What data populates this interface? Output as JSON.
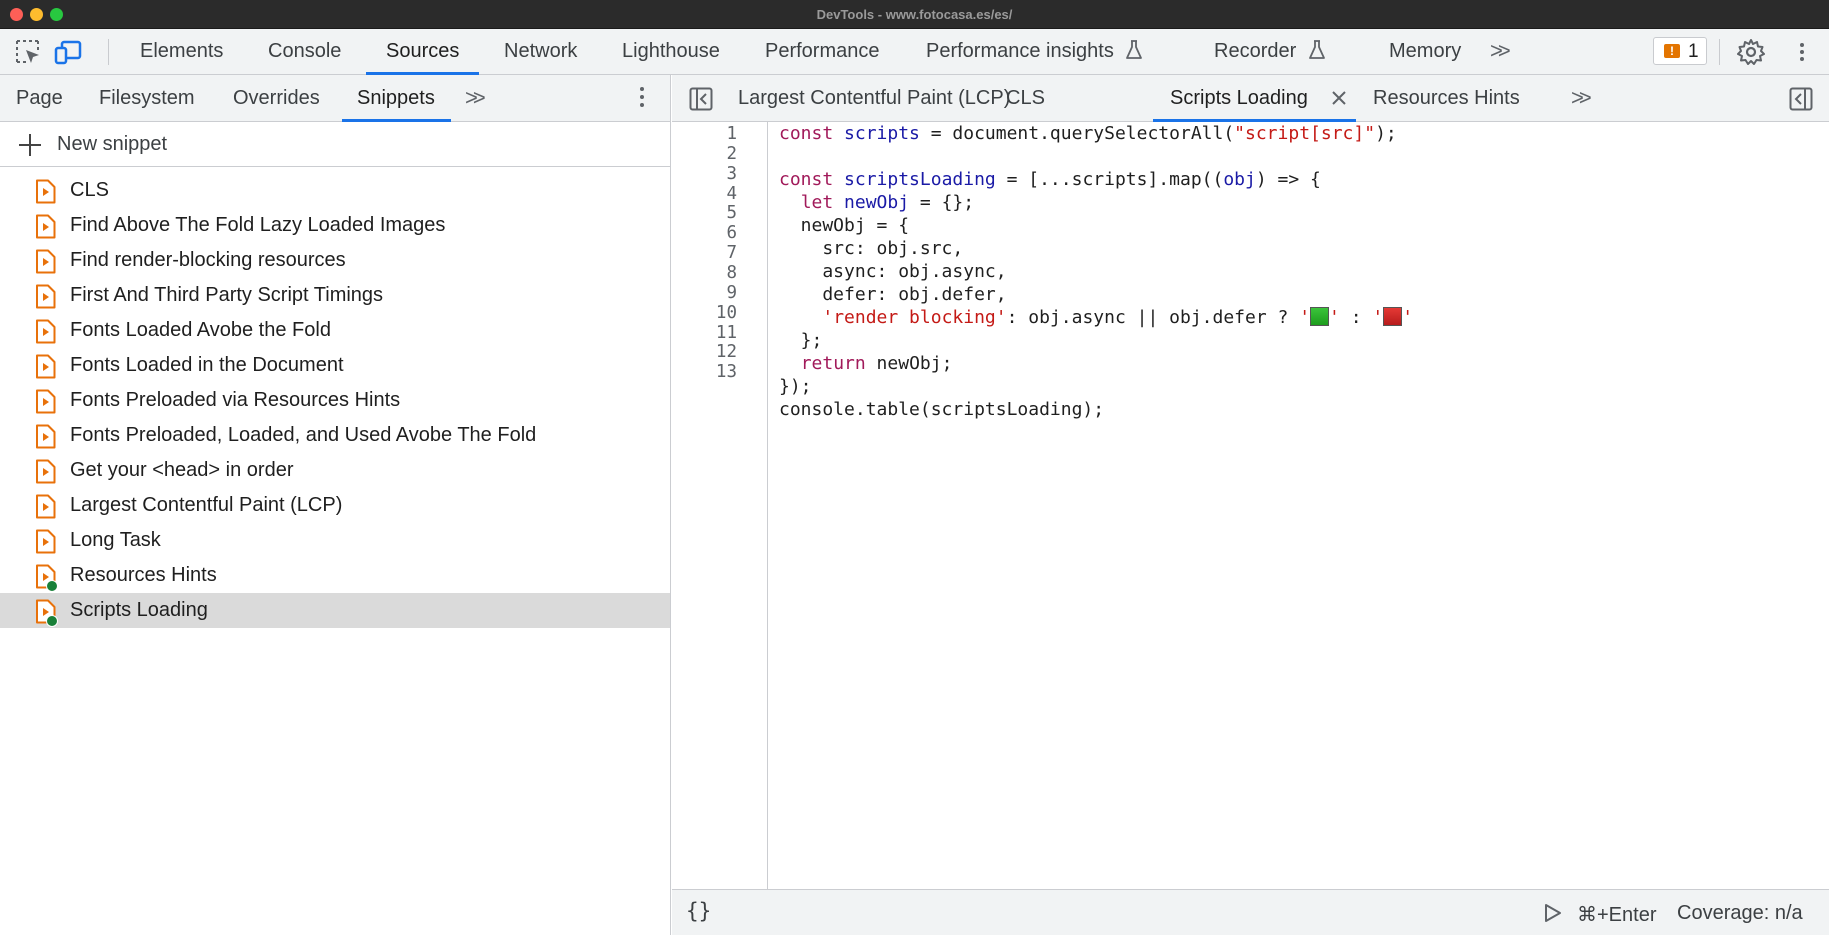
{
  "window": {
    "title": "DevTools - www.fotocasa.es/es/"
  },
  "main_tabs": [
    {
      "label": "Elements"
    },
    {
      "label": "Console"
    },
    {
      "label": "Sources"
    },
    {
      "label": "Network"
    },
    {
      "label": "Lighthouse"
    },
    {
      "label": "Performance"
    },
    {
      "label": "Performance insights"
    },
    {
      "label": "Recorder"
    },
    {
      "label": "Memory"
    }
  ],
  "active_main_tab": "Sources",
  "issues": {
    "count": "1",
    "icon": "warning-flag-icon",
    "color": "#e37400"
  },
  "nav_tabs": [
    {
      "label": "Page"
    },
    {
      "label": "Filesystem"
    },
    {
      "label": "Overrides"
    },
    {
      "label": "Snippets"
    }
  ],
  "active_nav_tab": "Snippets",
  "new_snippet_label": "New snippet",
  "snippets": [
    {
      "label": "CLS",
      "modified": false
    },
    {
      "label": "Find Above The Fold Lazy Loaded Images",
      "modified": false
    },
    {
      "label": "Find render-blocking resources",
      "modified": false
    },
    {
      "label": "First And Third Party Script Timings",
      "modified": false
    },
    {
      "label": "Fonts Loaded Avobe the Fold",
      "modified": false
    },
    {
      "label": "Fonts Loaded in the Document",
      "modified": false
    },
    {
      "label": "Fonts Preloaded via Resources Hints",
      "modified": false
    },
    {
      "label": "Fonts Preloaded, Loaded, and Used Avobe The Fold",
      "modified": false
    },
    {
      "label": "Get your <head> in order",
      "modified": false
    },
    {
      "label": "Largest Contentful Paint (LCP)",
      "modified": false
    },
    {
      "label": "Long Task",
      "modified": false
    },
    {
      "label": "Resources Hints",
      "modified": true
    },
    {
      "label": "Scripts Loading",
      "modified": true,
      "selected": true
    }
  ],
  "editor_tabs": [
    {
      "label": "Largest Contentful Paint (LCP)"
    },
    {
      "label": "CLS"
    },
    {
      "label": "Scripts Loading",
      "active": true
    },
    {
      "label": "Resources Hints"
    }
  ],
  "code": {
    "line_numbers": [
      "1",
      "2",
      "3",
      "4",
      "5",
      "6",
      "7",
      "8",
      "9",
      "10",
      "11",
      "12",
      "13"
    ],
    "line1": {
      "kw": "const",
      "var": "scripts",
      "mid": " = document.querySelectorAll(",
      "str": "\"script[src]\"",
      "end": ");"
    },
    "line3": {
      "kw": "const",
      "var": "scriptsLoading",
      "mid": " = [...scripts].map((",
      "var2": "obj",
      "end": ") => {"
    },
    "line4": {
      "kw": "let",
      "var": "newObj",
      "end": " = {};"
    },
    "line5": "  newObj = {",
    "line6": "    src: obj.src,",
    "line7": "    async: obj.async,",
    "line8": "    defer: obj.defer,",
    "line9": {
      "str": "'render blocking'",
      "mid": ": obj.async || obj.defer ? ",
      "q1": "'",
      "q2": "'",
      "sep": " : ",
      "q3": "'",
      "q4": "'",
      "green_emoji": "green-square-icon",
      "red_emoji": "red-square-icon"
    },
    "line10": "  };",
    "line11": {
      "kw": "return",
      "end": " newObj;"
    },
    "line12": "});",
    "line13": "console.table(scriptsLoading);"
  },
  "status_bar": {
    "format_label": "{}",
    "run_label": "⌘+Enter",
    "coverage_label": "Coverage: n/a"
  },
  "colors": {
    "accent": "#1a73e8",
    "snippet_icon": "#e8710a",
    "modified_dot": "#188038",
    "keyword": "#a11a5a",
    "variable": "#1a1aa6",
    "string": "#c41a16"
  }
}
